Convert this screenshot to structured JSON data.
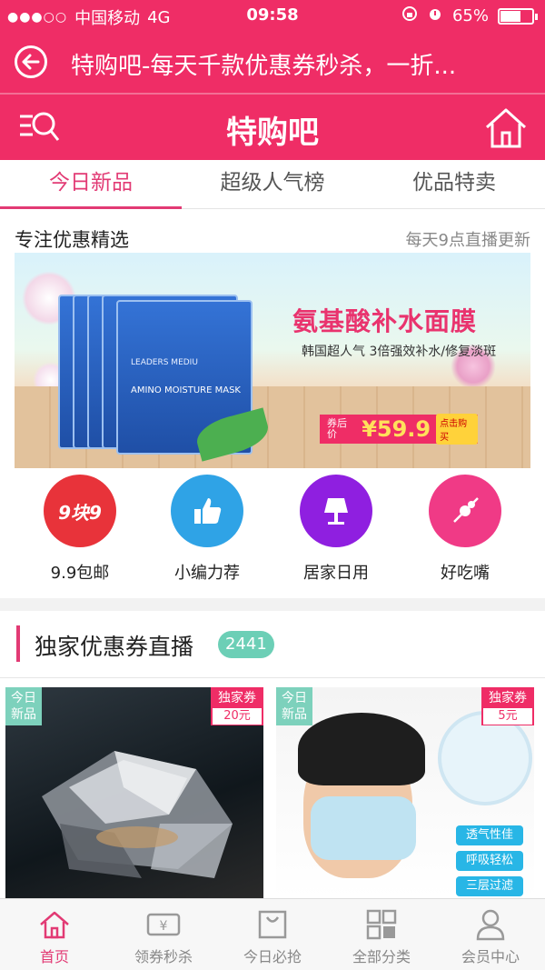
{
  "status_bar": {
    "signal": "●●●○○",
    "carrier": "中国移动",
    "network": "4G",
    "time": "09:58",
    "battery": "65%",
    "battery_level": 0.65
  },
  "browser": {
    "title": "特购吧-每天千款优惠券秒杀，一折..."
  },
  "app_header": {
    "title": "特购吧"
  },
  "tabs": [
    {
      "label": "今日新品",
      "active": true
    },
    {
      "label": "超级人气榜",
      "active": false
    },
    {
      "label": "优品特卖",
      "active": false
    }
  ],
  "featured": {
    "label": "专注优惠精选",
    "note": "每天9点直播更新",
    "banner": {
      "headline": "氨基酸补水面膜",
      "subtitle": "韩国超人气 3倍强效补水/修复淡斑",
      "price_label": "券后价",
      "price": "¥59.9",
      "buy_label": "点击购买",
      "pack_brand": "LEADERS MEDIU",
      "pack_product": "AMINO MOISTURE MASK"
    }
  },
  "categories": [
    {
      "label": "9.9包邮",
      "icon_text": "9块9",
      "color": "#e8333a"
    },
    {
      "label": "小编力荐",
      "icon_text": "👍",
      "color": "#2fa3e6"
    },
    {
      "label": "居家日用",
      "icon_text": "",
      "color": "#8f1fe0"
    },
    {
      "label": "好吃嘴",
      "icon_text": "",
      "color": "#f03a86"
    }
  ],
  "coupon_section": {
    "title": "独家优惠券直播",
    "count": "2441"
  },
  "products": [
    {
      "new_tag": "今日新品",
      "coupon_tag": "独家券",
      "coupon_amount": "20元"
    },
    {
      "new_tag": "今日新品",
      "coupon_tag": "独家券",
      "coupon_amount": "5元",
      "features": [
        "透气性佳",
        "呼吸轻松",
        "三层过滤"
      ]
    }
  ],
  "bottom_nav": [
    {
      "label": "首页",
      "icon": "home-icon",
      "active": true
    },
    {
      "label": "领券秒杀",
      "icon": "coupon-icon",
      "active": false
    },
    {
      "label": "今日必抢",
      "icon": "bag-icon",
      "active": false
    },
    {
      "label": "全部分类",
      "icon": "grid-icon",
      "active": false
    },
    {
      "label": "会员中心",
      "icon": "user-icon",
      "active": false
    }
  ]
}
